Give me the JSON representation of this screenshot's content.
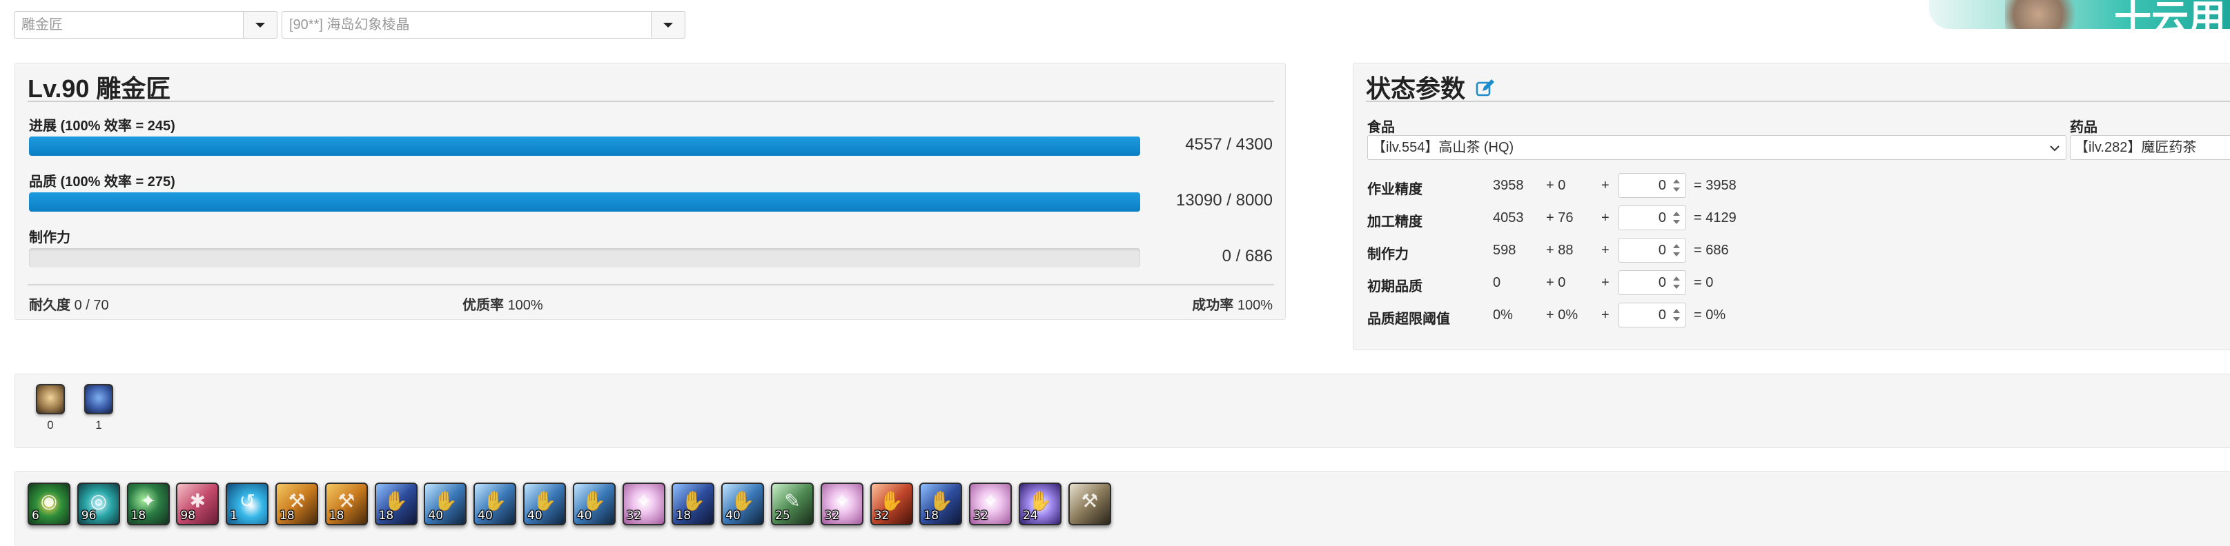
{
  "top": {
    "job_select": "雕金匠",
    "recipe_select": "[90**] 海岛幻象棱晶"
  },
  "banner": {
    "text": "十云用"
  },
  "craft": {
    "title": "Lv.90 雕金匠",
    "progress": {
      "label": "进展 (100% 效率 = 245)",
      "value": "4557 / 4300",
      "fill": 1.0
    },
    "quality": {
      "label": "品质  (100% 效率 = 275)",
      "value": "13090 / 8000",
      "fill": 1.0
    },
    "cp": {
      "label": "制作力",
      "value": "0 / 686",
      "fill": 0.0
    },
    "durability": {
      "label": "耐久度",
      "value": "0 / 70"
    },
    "hq": {
      "label": "优质率",
      "value": "100%"
    },
    "success": {
      "label": "成功率",
      "value": "100%"
    }
  },
  "status": {
    "title": "状态参数",
    "edit_icon": "edit-icon",
    "food_label": "食品",
    "food_value": "【ilv.554】高山茶 (HQ)",
    "medicine_label": "药品",
    "medicine_value": "【ilv.282】魔匠药茶",
    "rows": [
      {
        "name": "作业精度",
        "base": "3958",
        "bonus": "+ 0",
        "plus": "+",
        "input": "0",
        "total": "= 3958"
      },
      {
        "name": "加工精度",
        "base": "4053",
        "bonus": "+ 76",
        "plus": "+",
        "input": "0",
        "total": "= 4129"
      },
      {
        "name": "制作力",
        "base": "598",
        "bonus": "+ 88",
        "plus": "+",
        "input": "0",
        "total": "= 686"
      },
      {
        "name": "初期品质",
        "base": "0",
        "bonus": "+ 0",
        "plus": "+",
        "input": "0",
        "total": "= 0"
      },
      {
        "name": "品质超限阈值",
        "base": "0%",
        "bonus": "+ 0%",
        "plus": "+",
        "input": "0",
        "total": "= 0%"
      }
    ]
  },
  "buffs": [
    {
      "icon": "inner-quiet-icon",
      "count": "0"
    },
    {
      "icon": "manipulation-icon",
      "count": "1"
    }
  ],
  "skills": [
    {
      "icon": "muscle-memory-icon",
      "num": "6"
    },
    {
      "icon": "reflect-icon",
      "num": "96"
    },
    {
      "icon": "veneration-icon",
      "num": "18"
    },
    {
      "icon": "waste-not-ii-icon",
      "num": "98"
    },
    {
      "icon": "manipulation-icon",
      "num": "1"
    },
    {
      "icon": "groundwork-icon",
      "num": "18"
    },
    {
      "icon": "groundwork-icon",
      "num": "18"
    },
    {
      "icon": "innovation-icon",
      "num": "18"
    },
    {
      "icon": "basic-touch-icon",
      "num": "40"
    },
    {
      "icon": "basic-touch-icon",
      "num": "40"
    },
    {
      "icon": "basic-touch-icon",
      "num": "40"
    },
    {
      "icon": "basic-touch-icon",
      "num": "40"
    },
    {
      "icon": "great-strides-icon",
      "num": "32"
    },
    {
      "icon": "innovation-icon",
      "num": "18"
    },
    {
      "icon": "basic-touch-icon",
      "num": "40"
    },
    {
      "icon": "trained-finesse-icon",
      "num": "25"
    },
    {
      "icon": "great-strides-icon",
      "num": "32"
    },
    {
      "icon": "preparatory-touch-icon",
      "num": "32"
    },
    {
      "icon": "innovation-icon",
      "num": "18"
    },
    {
      "icon": "great-strides-icon",
      "num": "32"
    },
    {
      "icon": "byregots-blessing-icon",
      "num": "24"
    },
    {
      "icon": "careful-synthesis-icon",
      "num": ""
    }
  ]
}
